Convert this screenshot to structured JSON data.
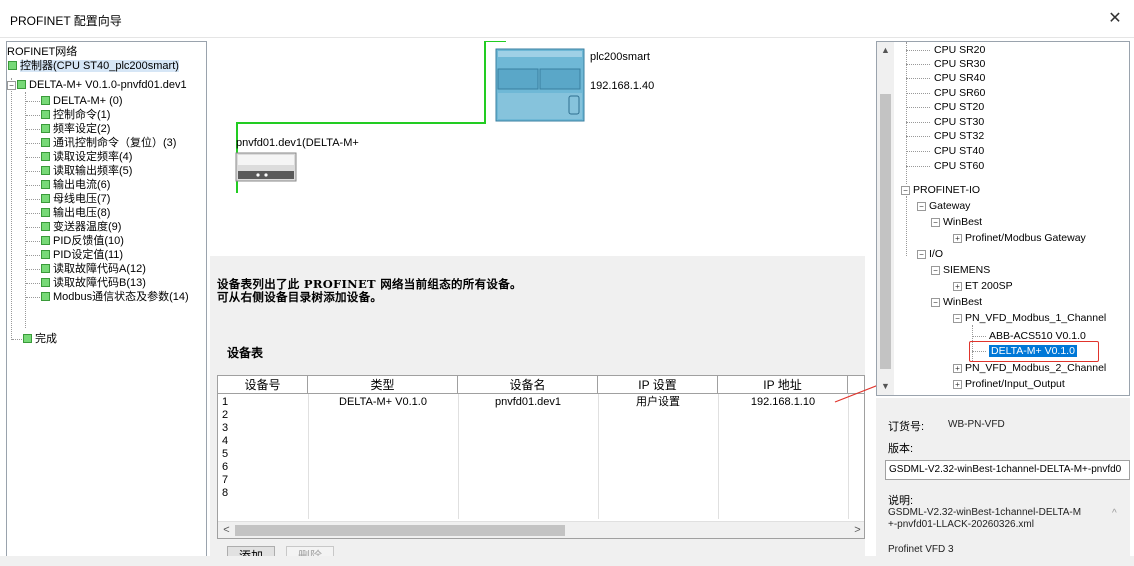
{
  "window": {
    "title": "PROFINET 配置向导",
    "close_glyph": "✕"
  },
  "left_tree": {
    "root": "ROFINET网络",
    "controller": "控制器(CPU ST40_plc200smart)",
    "device": "DELTA-M+ V0.1.0-pnvfd01.dev1",
    "items": [
      "DELTA-M+ (0)",
      "控制命令(1)",
      "频率设定(2)",
      "通讯控制命令（复位）(3)",
      "读取设定频率(4)",
      "读取输出频率(5)",
      "输出电流(6)",
      "母线电压(7)",
      "输出电压(8)",
      "变送器温度(9)",
      "PID反馈值(10)",
      "PID设定值(11)",
      "读取故障代码A(12)",
      "读取故障代码B(13)",
      "Modbus通信状态及参数(14)"
    ],
    "done": "完成"
  },
  "network": {
    "plc_name": "plc200smart",
    "plc_ip": "192.168.1.40",
    "device_label": "pnvfd01.dev1(DELTA-M+"
  },
  "center": {
    "description_line1": "设备表列出了此 PROFINET 网络当前组态的所有设备。",
    "description_line2": "可从右侧设备目录树添加设备。",
    "table_title": "设备表",
    "columns": [
      "设备号",
      "类型",
      "设备名",
      "IP 设置",
      "IP 地址"
    ],
    "rows": [
      {
        "no": "1",
        "type": "DELTA-M+ V0.1.0",
        "name": "pnvfd01.dev1",
        "ip_setting": "用户设置",
        "ip": "192.168.1.10"
      },
      {
        "no": "2",
        "type": "",
        "name": "",
        "ip_setting": "",
        "ip": ""
      },
      {
        "no": "3",
        "type": "",
        "name": "",
        "ip_setting": "",
        "ip": ""
      },
      {
        "no": "4",
        "type": "",
        "name": "",
        "ip_setting": "",
        "ip": ""
      },
      {
        "no": "5",
        "type": "",
        "name": "",
        "ip_setting": "",
        "ip": ""
      },
      {
        "no": "6",
        "type": "",
        "name": "",
        "ip_setting": "",
        "ip": ""
      },
      {
        "no": "7",
        "type": "",
        "name": "",
        "ip_setting": "",
        "ip": ""
      },
      {
        "no": "8",
        "type": "",
        "name": "",
        "ip_setting": "",
        "ip": ""
      }
    ],
    "add_button": "添加",
    "delete_button": "删除"
  },
  "catalog": {
    "cpus": [
      "CPU SR20",
      "CPU SR30",
      "CPU SR40",
      "CPU SR60",
      "CPU ST20",
      "CPU ST30",
      "CPU ST32",
      "CPU ST40",
      "CPU ST60"
    ],
    "profinet_io": "PROFINET-IO",
    "gateway": "Gateway",
    "winbest1": "WinBest",
    "pm_gateway": "Profinet/Modbus Gateway",
    "io": "I/O",
    "siemens": "SIEMENS",
    "et200sp": "ET 200SP",
    "winbest2": "WinBest",
    "ch1": "PN_VFD_Modbus_1_Channel",
    "abb": "ABB-ACS510 V0.1.0",
    "delta": "DELTA-M+ V0.1.0",
    "ch2": "PN_VFD_Modbus_2_Channel",
    "pio": "Profinet/Input_Output"
  },
  "info": {
    "order_label": "订货号:",
    "order_value": "WB-PN-VFD",
    "version_label": "版本:",
    "gsd_value": "GSDML-V2.32-winBest-1channel-DELTA-M+-pnvfd0",
    "desc_label": "说明:",
    "desc_line1": "GSDML-V2.32-winBest-1channel-DELTA-M",
    "desc_line2": "+-pnvfd01-LLACK-20260326.xml",
    "product": "Profinet VFD 3"
  },
  "colors": {
    "link": "#22cc22",
    "plc": "#6fb8d6",
    "selection": "#0078d7",
    "annotation": "#e0342c"
  }
}
